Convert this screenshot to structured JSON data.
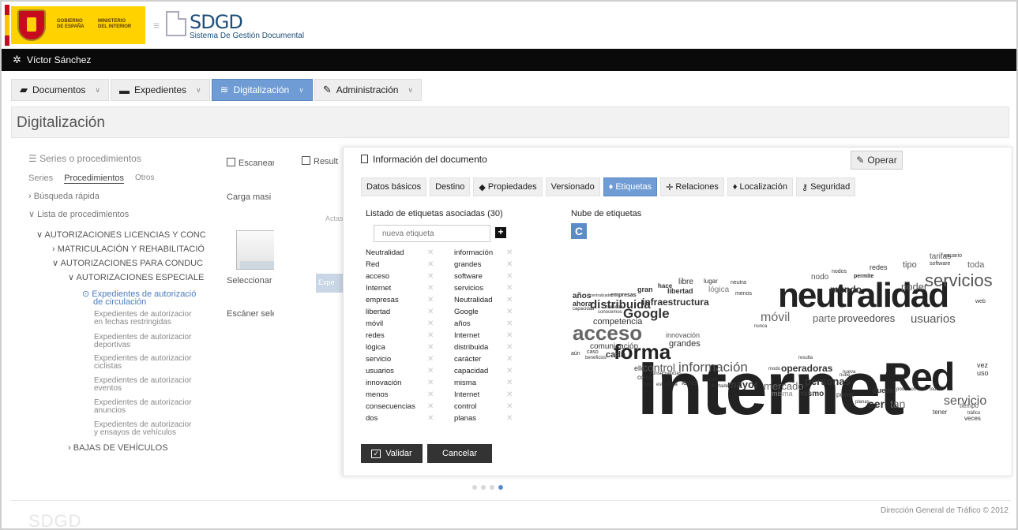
{
  "header": {
    "gov_line1": "GOBIERNO",
    "gov_line2": "DE ESPAÑA",
    "min_line1": "MINISTERIO",
    "min_line2": "DEL INTERIOR",
    "app_title": "SDGD",
    "app_subtitle": "Sistema De Gestión Documental"
  },
  "user": {
    "name": "Víctor Sánchez",
    "icon": "gear-icon"
  },
  "nav": [
    {
      "label": "Documentos",
      "icon": "folder-icon"
    },
    {
      "label": "Expedientes",
      "icon": "folders-icon"
    },
    {
      "label": "Digitalización",
      "icon": "layers-icon"
    },
    {
      "label": "Administración",
      "icon": "wrench-icon"
    }
  ],
  "page_title": "Digitalización",
  "left": {
    "header": "Series o procedimientos",
    "tabs": [
      "Series",
      "Procedimientos",
      "Otros"
    ],
    "quick_search": "Búsqueda rápida",
    "list": "Lista de procedimientos",
    "n1": "AUTORIZACIONES LICENCIAS Y CONC",
    "n2": "MATRICULACIÓN Y REHABILITACIÓ",
    "n3": "AUTORIZACIONES PARA CONDUC",
    "n4": "AUTORIZACIONES ESPECIALE",
    "sel1": "Expedientes de autorizació",
    "sel2": "de circulación",
    "s1a": "Expedientes de autorizacior",
    "s1b": "en fechas restringidas",
    "s2a": "Expedientes de autorizacior",
    "s2b": "deportivas",
    "s3a": "Expedientes de autorizacior",
    "s3b": "ciclistas",
    "s4a": "Expedientes de autorizacior",
    "s4b": "eventos",
    "s5a": "Expedientes de autorizacior",
    "s5b": "anuncios",
    "s6a": "Expedientes de autorizacior",
    "s6b": "y ensayos de vehículos",
    "n5": "BAJAS DE VEHÍCULOS"
  },
  "mid1": {
    "tab": "Escanear c",
    "carga": "Carga masi",
    "select": "Seleccionar",
    "scanner": "Escáner sele"
  },
  "mid2": {
    "tab": "Result",
    "actas": "Actas",
    "btn": "Expe"
  },
  "doc": {
    "title": "Información del documento",
    "operar": "Operar",
    "tabs": [
      "Datos básicos",
      "Destino",
      "Propiedades",
      "Versionado",
      "Etiquetas",
      "Relaciones",
      "Localización",
      "Seguridad"
    ],
    "list_title": "Listado de etiquetas asociadas (30)",
    "new_tag_placeholder": "nueva etiqueta",
    "tags_left": [
      "Neutralidad",
      "Red",
      "acceso",
      "Internet",
      "empresas",
      "libertad",
      "móvil",
      "redes",
      "lógica",
      "servicio",
      "usuarios",
      "innovación",
      "menos",
      "consecuencias",
      "dos"
    ],
    "tags_right": [
      "información",
      "grandes",
      "software",
      "servicios",
      "Neutralidad",
      "Google",
      "años",
      "Internet",
      "distribuida",
      "carácter",
      "capacidad",
      "misma",
      "Internet",
      "control",
      "planas"
    ],
    "cloud_title": "Nube de etiquetas",
    "validar": "Validar",
    "cancelar": "Cancelar"
  },
  "cloud_words": [
    [
      "Internet",
      "#222",
      100,
      140,
      96,
      "bold"
    ],
    [
      "neutralidad",
      "#222",
      278,
      48,
      44,
      "bold"
    ],
    [
      "Red",
      "#222",
      412,
      148,
      50,
      "bold"
    ],
    [
      "servicios",
      "#555",
      464,
      40,
      22,
      "normal"
    ],
    [
      "forma",
      "#222",
      70,
      128,
      26,
      "bold"
    ],
    [
      "acceso",
      "#666",
      18,
      104,
      26,
      "bold"
    ],
    [
      "Google",
      "#333",
      82,
      84,
      17,
      "bold"
    ],
    [
      "distribuida",
      "#333",
      40,
      74,
      15,
      "bold"
    ],
    [
      "información",
      "#555",
      152,
      152,
      17,
      "normal"
    ],
    [
      "control",
      "#555",
      106,
      154,
      14,
      "normal"
    ],
    [
      "servicio",
      "#555",
      488,
      196,
      16,
      "normal"
    ],
    [
      "ser",
      "#333",
      392,
      200,
      14,
      "bold"
    ],
    [
      "tan",
      "#666",
      420,
      200,
      14,
      "normal"
    ],
    [
      "mayor",
      "#333",
      214,
      176,
      13,
      "bold"
    ],
    [
      "mercado",
      "#666",
      260,
      178,
      13,
      "normal"
    ],
    [
      "personas",
      "#333",
      312,
      172,
      13,
      "bold"
    ],
    [
      "operadoras",
      "#333",
      282,
      156,
      12,
      "bold"
    ],
    [
      "usuarios",
      "#555",
      446,
      92,
      15,
      "normal"
    ],
    [
      "proveedores",
      "#444",
      354,
      92,
      13,
      "normal"
    ],
    [
      "parte",
      "#666",
      322,
      92,
      13,
      "normal"
    ],
    [
      "móvil",
      "#666",
      256,
      90,
      16,
      "normal"
    ],
    [
      "poder",
      "#555",
      434,
      52,
      13,
      "normal"
    ],
    [
      "mundo",
      "#333",
      344,
      56,
      12,
      "bold"
    ],
    [
      "infraestructura",
      "#333",
      106,
      72,
      12,
      "bold"
    ],
    [
      "competencia",
      "#333",
      44,
      98,
      11,
      "normal"
    ],
    [
      "grandes",
      "#333",
      140,
      126,
      11,
      "normal"
    ],
    [
      "innovación",
      "#555",
      136,
      116,
      9,
      "normal"
    ],
    [
      "comunicación",
      "#333",
      40,
      130,
      10,
      "normal"
    ],
    [
      "cada",
      "#333",
      60,
      140,
      11,
      "bold"
    ],
    [
      "ello",
      "#333",
      96,
      158,
      9,
      "normal"
    ],
    [
      "libertad",
      "#333",
      138,
      60,
      9,
      "bold"
    ],
    [
      "lógica",
      "#777",
      190,
      58,
      10,
      "normal"
    ],
    [
      "libre",
      "#333",
      152,
      48,
      10,
      "normal"
    ],
    [
      "lugar",
      "#333",
      184,
      48,
      8,
      "normal"
    ],
    [
      "gran",
      "#333",
      100,
      58,
      9,
      "bold"
    ],
    [
      "hace",
      "#333",
      126,
      54,
      8,
      "bold"
    ],
    [
      "años",
      "#333",
      18,
      66,
      10,
      "bold"
    ],
    [
      "ahora",
      "#333",
      18,
      76,
      9,
      "bold"
    ],
    [
      "nodo",
      "#555",
      320,
      42,
      10,
      "normal"
    ],
    [
      "redes",
      "#333",
      394,
      30,
      9,
      "normal"
    ],
    [
      "tipo",
      "#555",
      436,
      26,
      11,
      "normal"
    ],
    [
      "toda",
      "#666",
      518,
      26,
      11,
      "normal"
    ],
    [
      "tarifas",
      "#555",
      470,
      16,
      10,
      "normal"
    ],
    [
      "mismo",
      "#333",
      304,
      190,
      10,
      "bold"
    ],
    [
      "misma",
      "#888",
      270,
      190,
      9,
      "normal"
    ],
    [
      "puede",
      "#333",
      398,
      186,
      9,
      "bold"
    ],
    [
      "pueda",
      "#333",
      352,
      192,
      8,
      "normal"
    ],
    [
      "tener",
      "#333",
      474,
      214,
      8,
      "normal"
    ],
    [
      "vez",
      "#333",
      530,
      154,
      9,
      "normal"
    ],
    [
      "uso",
      "#333",
      530,
      164,
      9,
      "normal"
    ],
    [
      "tiempo",
      "#555",
      508,
      206,
      8,
      "normal"
    ],
    [
      "veces",
      "#333",
      514,
      222,
      8,
      "normal"
    ],
    [
      "leyes",
      "#333",
      156,
      176,
      9,
      "normal"
    ],
    [
      "como",
      "#333",
      100,
      170,
      8,
      "normal"
    ],
    [
      "dos",
      "#333",
      108,
      180,
      6,
      "normal"
    ],
    [
      "estructura",
      "#333",
      124,
      180,
      6,
      "normal"
    ],
    [
      "hacer",
      "#333",
      186,
      174,
      6,
      "normal"
    ],
    [
      "libertades",
      "#333",
      192,
      182,
      6,
      "normal"
    ],
    [
      "web",
      "#333",
      528,
      74,
      7,
      "normal"
    ],
    [
      "empresas",
      "#333",
      66,
      66,
      7,
      "bold"
    ],
    [
      "centralizado",
      "#333",
      40,
      68,
      5,
      "normal"
    ],
    [
      "capacidad",
      "#333",
      18,
      84,
      6,
      "normal"
    ],
    [
      "carácter",
      "#333",
      60,
      82,
      6,
      "normal"
    ],
    [
      "conocemos",
      "#333",
      50,
      88,
      6,
      "normal"
    ],
    [
      "aún",
      "#333",
      16,
      140,
      7,
      "normal"
    ],
    [
      "caso",
      "#333",
      36,
      138,
      7,
      "normal"
    ],
    [
      "beneficios",
      "#333",
      34,
      146,
      6,
      "normal"
    ],
    [
      "neutra",
      "#333",
      218,
      50,
      7,
      "normal"
    ],
    [
      "menos",
      "#333",
      224,
      64,
      7,
      "normal"
    ],
    [
      "nodos",
      "#333",
      346,
      36,
      7,
      "normal"
    ],
    [
      "permite",
      "#333",
      374,
      42,
      7,
      "bold"
    ],
    [
      "usuario",
      "#333",
      488,
      16,
      7,
      "normal"
    ],
    [
      "software",
      "#333",
      470,
      26,
      7,
      "normal"
    ],
    [
      "nunca",
      "#333",
      248,
      106,
      6,
      "normal"
    ],
    [
      "resulta",
      "#333",
      304,
      146,
      6,
      "normal"
    ],
    [
      "modo",
      "#333",
      266,
      160,
      6,
      "normal"
    ],
    [
      "nueva",
      "#333",
      360,
      164,
      6,
      "normal"
    ],
    [
      "nube",
      "#333",
      356,
      168,
      6,
      "normal"
    ],
    [
      "podemos",
      "#333",
      428,
      186,
      6,
      "normal"
    ],
    [
      "todos",
      "#333",
      470,
      186,
      6,
      "normal"
    ],
    [
      "planas",
      "#333",
      376,
      202,
      6,
      "normal"
    ],
    [
      "tráfico",
      "#333",
      518,
      216,
      6,
      "normal"
    ],
    [
      "consecuencias",
      "#333",
      116,
      166,
      6,
      "normal"
    ]
  ],
  "pager": {
    "count": 4,
    "active": 4
  },
  "footer": {
    "copyright": "Dirección General de Tráfico © 2012",
    "brand": "SDGD"
  }
}
